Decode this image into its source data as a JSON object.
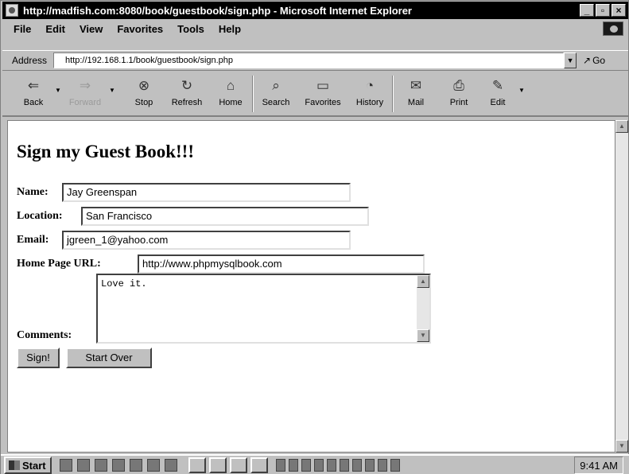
{
  "window": {
    "title": "http://madfish.com:8080/book/guestbook/sign.php - Microsoft Internet Explorer",
    "minimize": "_",
    "maximize": "▫",
    "close": "×"
  },
  "menu": {
    "items": [
      "File",
      "Edit",
      "View",
      "Favorites",
      "Tools",
      "Help"
    ]
  },
  "address": {
    "label": "Address",
    "url": "http://192.168.1.1/book/guestbook/sign.php",
    "go": "Go"
  },
  "toolbar": {
    "buttons": [
      {
        "label": "Back",
        "icon": "back-arrow-icon",
        "glyph": "⇐"
      },
      {
        "label": "Forward",
        "icon": "forward-arrow-icon",
        "glyph": "⇒"
      },
      {
        "label": "Stop",
        "icon": "stop-icon",
        "glyph": "⊗"
      },
      {
        "label": "Refresh",
        "icon": "refresh-icon",
        "glyph": "↻"
      },
      {
        "label": "Home",
        "icon": "home-icon",
        "glyph": "⌂"
      },
      {
        "label": "Search",
        "icon": "search-icon",
        "glyph": "⌕"
      },
      {
        "label": "Favorites",
        "icon": "favorites-icon",
        "glyph": "▭"
      },
      {
        "label": "History",
        "icon": "history-icon",
        "glyph": "◔"
      },
      {
        "label": "Mail",
        "icon": "mail-icon",
        "glyph": "✉"
      },
      {
        "label": "Print",
        "icon": "print-icon",
        "glyph": "⎙"
      },
      {
        "label": "Edit",
        "icon": "edit-icon",
        "glyph": "✎"
      }
    ]
  },
  "page": {
    "title": "Sign my Guest Book!!!",
    "fields": {
      "name": {
        "label": "Name:",
        "value": "Jay Greenspan"
      },
      "location": {
        "label": "Location:",
        "value": "San Francisco"
      },
      "email": {
        "label": "Email:",
        "value": "jgreen_1@yahoo.com"
      },
      "url": {
        "label": "Home Page URL:",
        "value": "http://www.phpmysqlbook.com"
      },
      "comments": {
        "label": "Comments:",
        "value": "Love it."
      }
    },
    "buttons": {
      "sign": "Sign!",
      "reset": "Start Over"
    }
  },
  "taskbar": {
    "start": "Start",
    "clock": "9:41 AM"
  }
}
